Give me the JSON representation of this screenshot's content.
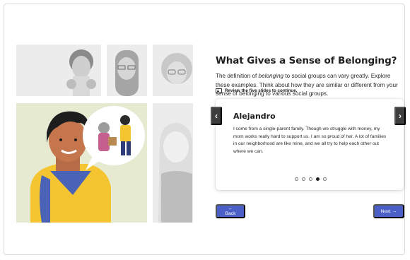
{
  "lesson": {
    "title": "What Gives a Sense of Belonging?",
    "description_prefix": "The definition of ",
    "description_emphasis": "belonging",
    "description_suffix": " to social groups can vary greatly. Explore these examples. Think about how they are similar or different from your sense of belonging to various social groups.",
    "review_text": "Review the five slides to continue.",
    "review_icon": "slides-icon"
  },
  "carousel": {
    "name": "Alejandro",
    "text": "I come from a single-parent family. Though we struggle with money, my mom works really hard to support us. I am so proud of her. A lot of families in our neighborhood are like mine, and we all try to help each other out where we can.",
    "prev_label": "‹",
    "next_label": "›",
    "slide_count": 5,
    "active_slide": 4
  },
  "nav": {
    "back_label": "← Back",
    "next_label": "Next →"
  },
  "colors": {
    "button_blue": "#4b5fc7",
    "arrow_dark": "#3e3e3e",
    "highlight_bg": "#e5ead1",
    "illustration_gray": "#ececec"
  }
}
